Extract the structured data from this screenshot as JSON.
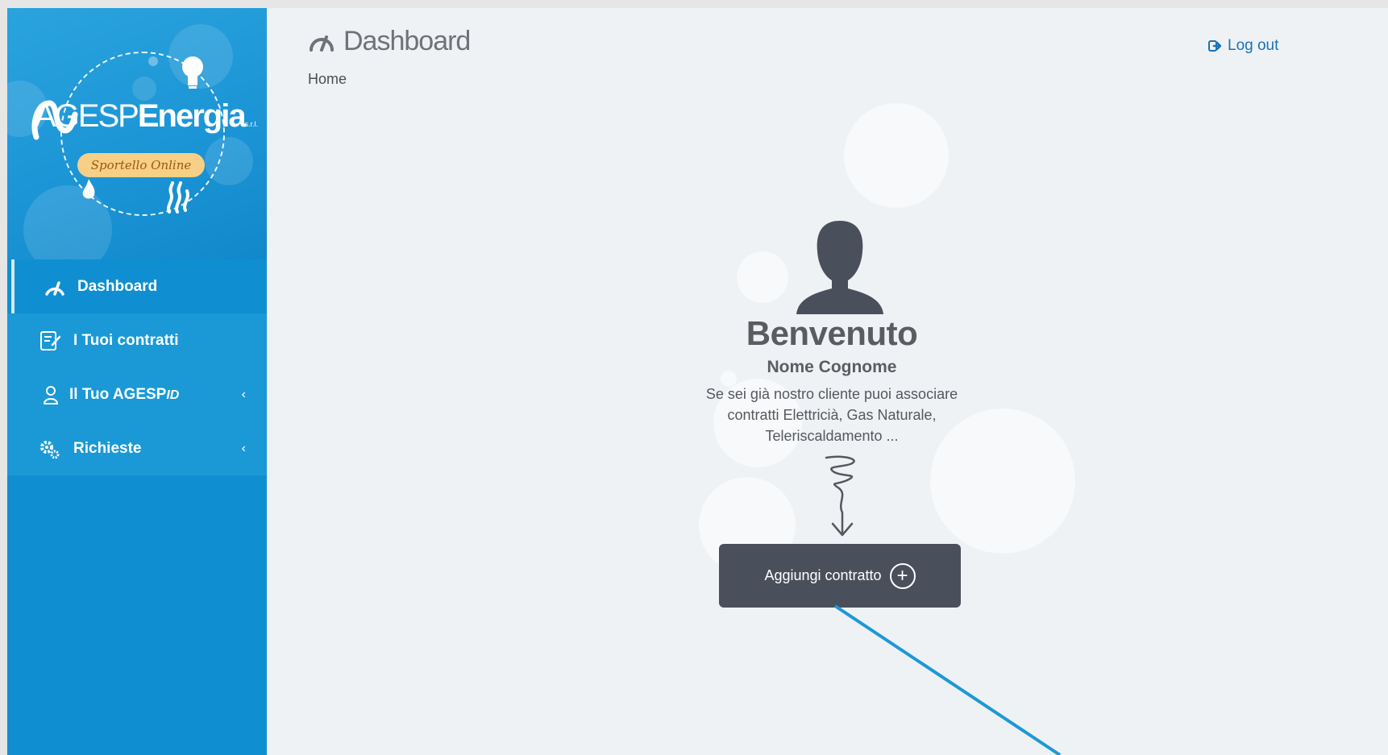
{
  "logo": {
    "brand_pre": "AGESP",
    "brand_bold": "Energia",
    "brand_suffix": "s.r.l.",
    "tagline": "Sportello Online"
  },
  "sidebar": {
    "items": [
      {
        "label": "Dashboard",
        "icon": "speedometer-icon",
        "active": true
      },
      {
        "label": "I Tuoi contratti",
        "icon": "contract-edit-icon"
      },
      {
        "label_main": "Il Tuo AGESP",
        "label_suffix": "ID",
        "icon": "user-icon",
        "chevron": "‹"
      },
      {
        "label": "Richieste",
        "icon": "gears-icon",
        "chevron": "‹"
      }
    ]
  },
  "header": {
    "title": "Dashboard",
    "breadcrumb": "Home",
    "logout_label": "Log out"
  },
  "welcome": {
    "title": "Benvenuto",
    "name": "Nome Cognome",
    "text_line1": "Se sei già nostro cliente puoi associare",
    "text_line2": "contratti Elettricià, Gas Naturale,",
    "text_line3": "Teleriscaldamento ...",
    "cta_label": "Aggiungi contratto",
    "cta_icon": "+"
  },
  "colors": {
    "sidebar": "#0f8fd2",
    "accent_link": "#1a73b8",
    "cta_bg": "#4a4f5c",
    "page_bg": "#eef2f5",
    "pointer_line": "#1e98d6"
  }
}
